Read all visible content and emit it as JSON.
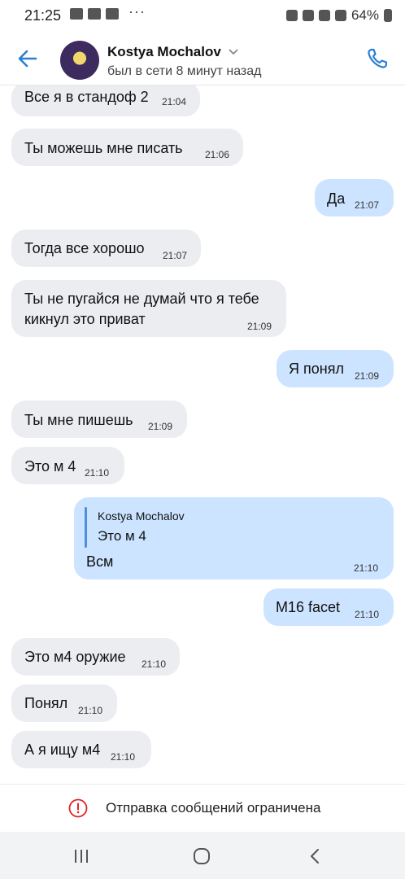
{
  "status_bar": {
    "time": "21:25",
    "dots": "···",
    "battery": "64%"
  },
  "header": {
    "name": "Kostya Mochalov",
    "status": "был в сети 8 минут назад"
  },
  "messages": [
    {
      "dir": "in",
      "text": "Все я в стандоф 2",
      "time": "21:04"
    },
    {
      "dir": "in",
      "text": "Ты можешь мне писать",
      "time": "21:06"
    },
    {
      "dir": "out",
      "text": "Да",
      "time": "21:07"
    },
    {
      "dir": "in",
      "text": "Тогда все хорошо",
      "time": "21:07"
    },
    {
      "dir": "in",
      "text": "Ты не пугайся не думай что я тебе",
      "text2": "кикнул это приват",
      "time": "21:09"
    },
    {
      "dir": "out",
      "text": "Я понял",
      "time": "21:09"
    },
    {
      "dir": "in",
      "text": "Ты мне пишешь",
      "time": "21:09"
    },
    {
      "dir": "in",
      "text": "Это м 4",
      "time": "21:10"
    },
    {
      "dir": "out",
      "quote_author": "Kostya Mochalov",
      "quote_text": "Это м 4",
      "text": "Всм",
      "time": "21:10"
    },
    {
      "dir": "out",
      "text": "M16 facet",
      "time": "21:10"
    },
    {
      "dir": "in",
      "text": "Это м4 оружие",
      "time": "21:10"
    },
    {
      "dir": "in",
      "text": "Понял",
      "time": "21:10"
    },
    {
      "dir": "in",
      "text": "А я ищу м4",
      "time": "21:10"
    }
  ],
  "composer": {
    "notice": "Отправка сообщений ограничена"
  },
  "colors": {
    "incoming_bubble": "#ebedf0",
    "outgoing_bubble": "#cce4ff",
    "accent": "#2a7fd4",
    "warning": "#e02424"
  }
}
